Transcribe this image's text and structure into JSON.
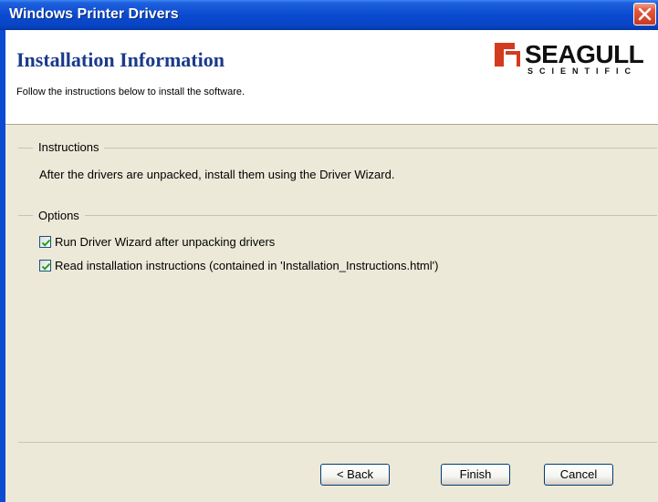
{
  "window": {
    "title": "Windows Printer Drivers"
  },
  "header": {
    "heading": "Installation Information",
    "subtitle": "Follow the instructions below to install the software.",
    "logo": {
      "brand": "SEAGULL",
      "sub": "SCIENTIFIC"
    }
  },
  "instructions": {
    "group_label": "Instructions",
    "text": "After the drivers are unpacked, install them using the Driver Wizard."
  },
  "options": {
    "group_label": "Options",
    "items": [
      {
        "label": "Run Driver Wizard after unpacking drivers",
        "checked": true
      },
      {
        "label": "Read installation instructions (contained in 'Installation_Instructions.html')",
        "checked": true
      }
    ]
  },
  "buttons": {
    "back": "< Back",
    "finish": "Finish",
    "cancel": "Cancel"
  },
  "colors": {
    "titlebar": "#0a4bd1",
    "heading": "#1a3a8a",
    "close": "#e2583e",
    "checkmark": "#21a121"
  }
}
